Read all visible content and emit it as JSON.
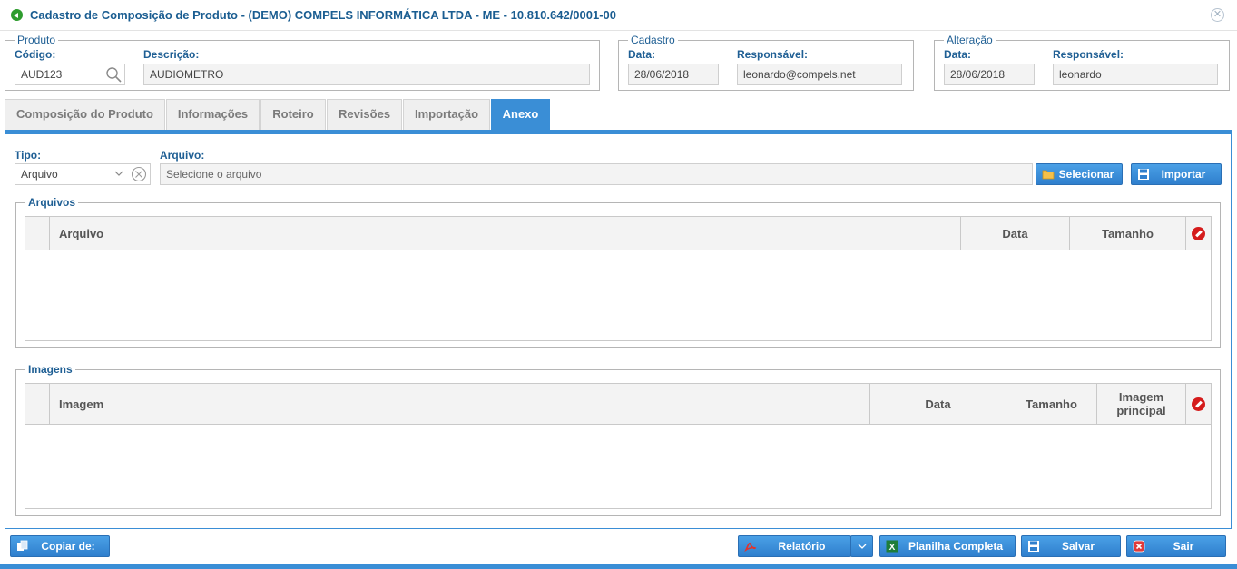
{
  "window": {
    "title": "Cadastro de Composição de Produto - (DEMO) COMPELS INFORMÁTICA LTDA - ME - 10.810.642/0001-00",
    "close_icon": "close-icon"
  },
  "produto": {
    "legend": "Produto",
    "codigo_label": "Código:",
    "codigo_value": "AUD123",
    "descricao_label": "Descrição:",
    "descricao_value": "AUDIOMETRO"
  },
  "cadastro": {
    "legend": "Cadastro",
    "data_label": "Data:",
    "data_value": "28/06/2018",
    "responsavel_label": "Responsável:",
    "responsavel_value": "leonardo@compels.net"
  },
  "alteracao": {
    "legend": "Alteração",
    "data_label": "Data:",
    "data_value": "28/06/2018",
    "responsavel_label": "Responsável:",
    "responsavel_value": "leonardo"
  },
  "tabs": [
    {
      "label": "Composição do Produto",
      "active": false
    },
    {
      "label": "Informações",
      "active": false
    },
    {
      "label": "Roteiro",
      "active": false
    },
    {
      "label": "Revisões",
      "active": false
    },
    {
      "label": "Importação",
      "active": false
    },
    {
      "label": "Anexo",
      "active": true
    }
  ],
  "anexo": {
    "tipo_label": "Tipo:",
    "tipo_value": "Arquivo",
    "arquivo_label": "Arquivo:",
    "arquivo_placeholder": "Selecione o arquivo",
    "selecionar_label": "Selecionar",
    "importar_label": "Importar"
  },
  "arquivos": {
    "legend": "Arquivos",
    "columns": [
      "Arquivo",
      "Data",
      "Tamanho"
    ],
    "rows": []
  },
  "imagens": {
    "legend": "Imagens",
    "columns": [
      "Imagem",
      "Data",
      "Tamanho",
      "Imagem principal"
    ],
    "rows": []
  },
  "footer": {
    "copiar_label": "Copiar de:",
    "relatorio_label": "Relatório",
    "planilha_label": "Planilha Completa",
    "salvar_label": "Salvar",
    "sair_label": "Sair"
  },
  "colors": {
    "accent": "#3a8ed6",
    "label": "#1f5f94",
    "delete": "#d51c1c",
    "excel": "#1e7d3a"
  }
}
